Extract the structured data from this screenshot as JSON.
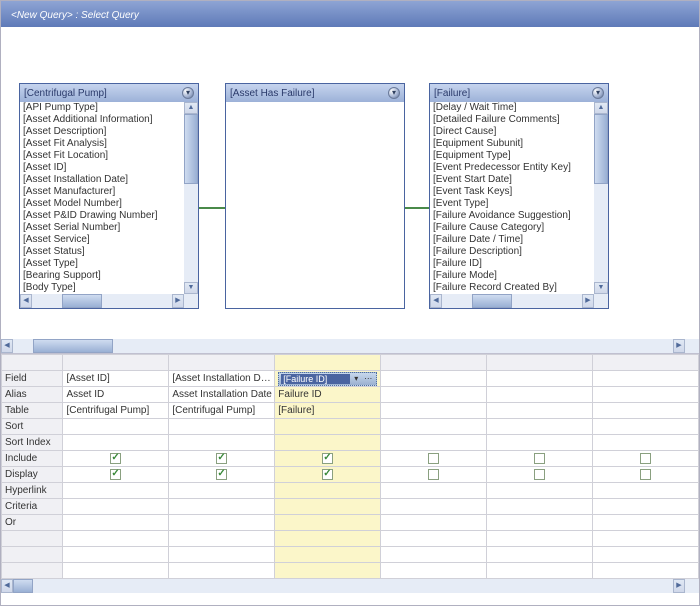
{
  "title": "<New Query> : Select Query",
  "entities": [
    {
      "name": "[Centrifugal Pump]",
      "fields": [
        "[API Pump Type]",
        "[Asset Additional Information]",
        "[Asset Description]",
        "[Asset Fit Analysis]",
        "[Asset Fit Location]",
        "[Asset ID]",
        "[Asset Installation Date]",
        "[Asset Manufacturer]",
        "[Asset Model Number]",
        "[Asset P&ID Drawing Number]",
        "[Asset Serial Number]",
        "[Asset Service]",
        "[Asset Status]",
        "[Asset Type]",
        "[Bearing Support]",
        "[Body Type]"
      ]
    },
    {
      "name": "[Asset Has Failure]",
      "fields": []
    },
    {
      "name": "[Failure]",
      "fields": [
        "[Delay / Wait Time]",
        "[Detailed Failure Comments]",
        "[Direct Cause]",
        "[Equipment Subunit]",
        "[Equipment Type]",
        "[Event Predecessor Entity Key]",
        "[Event Start Date]",
        "[Event Task Keys]",
        "[Event Type]",
        "[Failure Avoidance Suggestion]",
        "[Failure Cause Category]",
        "[Failure Date / Time]",
        "[Failure Description]",
        "[Failure ID]",
        "[Failure Mode]",
        "[Failure Record Created By]"
      ]
    }
  ],
  "grid": {
    "rowLabels": {
      "field": "Field",
      "alias": "Alias",
      "table": "Table",
      "sort": "Sort",
      "sortIndex": "Sort Index",
      "include": "Include",
      "display": "Display",
      "hyperlink": "Hyperlink",
      "criteria": "Criteria",
      "or": "Or"
    },
    "columns": [
      {
        "field": "[Asset ID]",
        "alias": "Asset ID",
        "table": "[Centrifugal Pump]",
        "include": true,
        "display": true,
        "selected": false
      },
      {
        "field": "[Asset Installation D…",
        "alias": "Asset Installation Date",
        "table": "[Centrifugal Pump]",
        "include": true,
        "display": true,
        "selected": false
      },
      {
        "field": "[Failure ID]",
        "alias": "Failure ID",
        "table": "[Failure]",
        "include": true,
        "display": true,
        "selected": true
      },
      {
        "field": "",
        "alias": "",
        "table": "",
        "include": false,
        "display": false,
        "selected": false
      },
      {
        "field": "",
        "alias": "",
        "table": "",
        "include": false,
        "display": false,
        "selected": false
      },
      {
        "field": "",
        "alias": "",
        "table": "",
        "include": false,
        "display": false,
        "selected": false
      }
    ]
  }
}
